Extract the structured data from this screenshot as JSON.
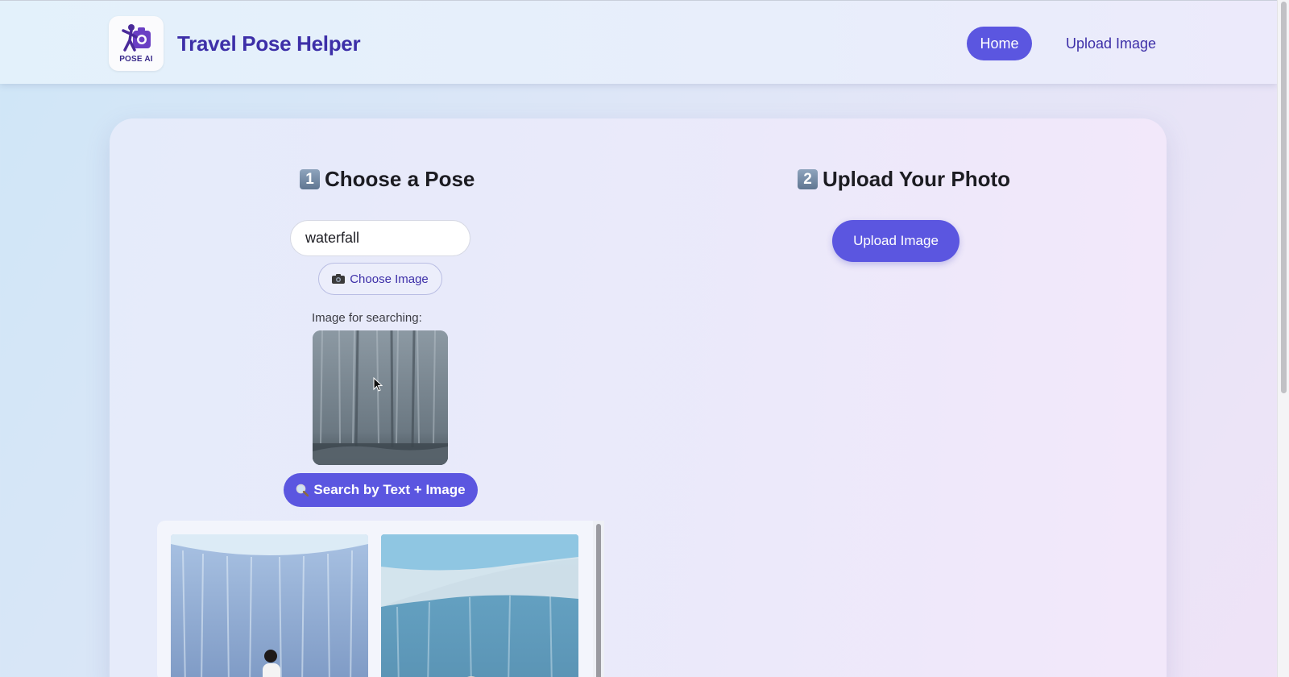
{
  "header": {
    "logo_text": "POSE AI",
    "brand_title": "Travel Pose Helper",
    "nav": {
      "home_label": "Home",
      "upload_label": "Upload Image"
    }
  },
  "left_section": {
    "heading_number": "1",
    "heading": "Choose a Pose",
    "search_value": "waterfall",
    "choose_image_label": "Choose Image",
    "image_label": "Image for searching:",
    "search_button_label": "Search by Text + Image"
  },
  "right_section": {
    "heading_number": "2",
    "heading": "Upload Your Photo",
    "upload_button_label": "Upload Image"
  },
  "icons": {
    "logo": "pose-logo-icon",
    "camera": "camera-icon",
    "search": "magnifier-icon"
  },
  "colors": {
    "accent": "#5b56e0",
    "brand_text": "#3d2fa8"
  }
}
